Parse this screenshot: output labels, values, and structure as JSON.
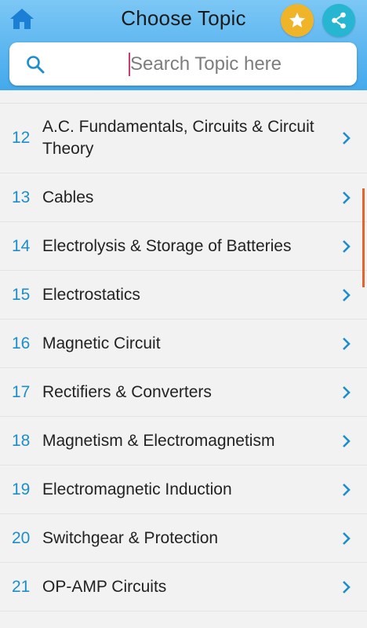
{
  "header": {
    "title": "Choose Topic",
    "home_icon": "home-icon",
    "favorite_icon": "star-icon",
    "share_icon": "share-icon"
  },
  "search": {
    "placeholder": "Search Topic here",
    "icon": "search-icon"
  },
  "topics": [
    {
      "number": "12",
      "label": "A.C. Fundamentals, Circuits & Circuit Theory"
    },
    {
      "number": "13",
      "label": "Cables"
    },
    {
      "number": "14",
      "label": "Electrolysis & Storage of Batteries"
    },
    {
      "number": "15",
      "label": "Electrostatics"
    },
    {
      "number": "16",
      "label": "Magnetic Circuit"
    },
    {
      "number": "17",
      "label": "Rectifiers & Converters"
    },
    {
      "number": "18",
      "label": "Magnetism & Electromagnetism"
    },
    {
      "number": "19",
      "label": "Electromagnetic Induction"
    },
    {
      "number": "20",
      "label": "Switchgear & Protection"
    },
    {
      "number": "21",
      "label": "OP-AMP Circuits"
    }
  ],
  "colors": {
    "header_gradient_top": "#7cc7f5",
    "header_gradient_bottom": "#43a9ec",
    "topic_number": "#1d8ec9",
    "favorite": "#f0b428",
    "share": "#27b6d2",
    "scrollbar": "#e8622c"
  }
}
